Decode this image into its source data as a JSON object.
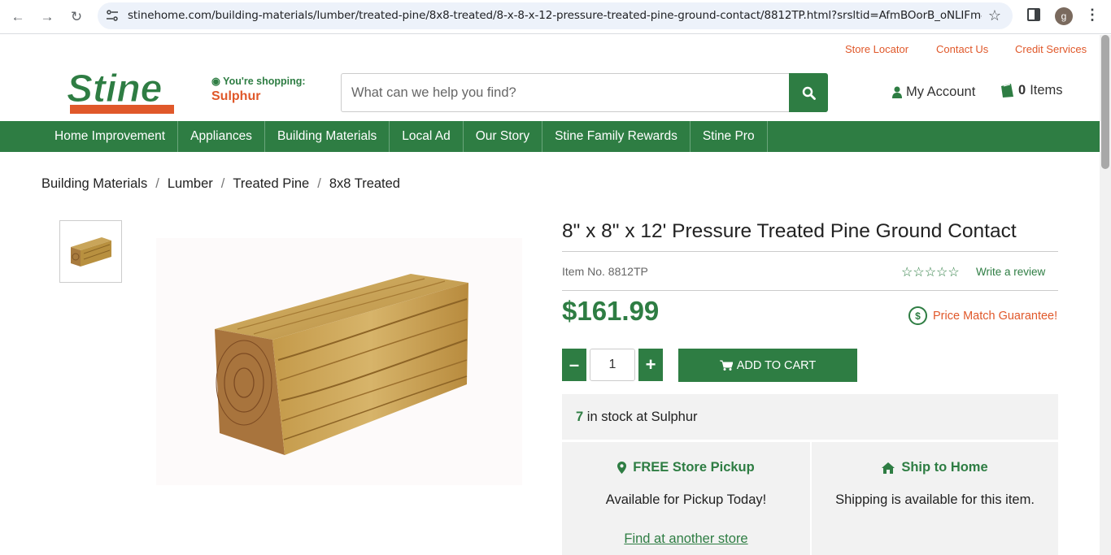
{
  "browser": {
    "url": "stinehome.com/building-materials/lumber/treated-pine/8x8-treated/8-x-8-x-12-pressure-treated-pine-ground-contact/8812TP.html?srsltid=AfmBOorB_oNLIFm4NqAfQ...",
    "profile_initial": "g"
  },
  "utility_links": [
    "Store Locator",
    "Contact Us",
    "Credit Services"
  ],
  "header": {
    "logo_text": "Stine",
    "shopping_label": "You're shopping:",
    "store_name": "Sulphur",
    "search_placeholder": "What can we help you find?",
    "account_label": "My Account",
    "cart_count": "0",
    "cart_label": "Items"
  },
  "main_nav": [
    "Home Improvement",
    "Appliances",
    "Building Materials",
    "Local Ad",
    "Our Story",
    "Stine Family Rewards",
    "Stine Pro"
  ],
  "breadcrumb": [
    "Building Materials",
    "Lumber",
    "Treated Pine",
    "8x8 Treated"
  ],
  "product": {
    "title": "8\" x 8\" x 12' Pressure Treated Pine Ground Contact",
    "item_no": "Item No. 8812TP",
    "rating_stars": 0,
    "write_review": "Write a review",
    "price": "$161.99",
    "price_match": "Price Match Guarantee!",
    "quantity": "1",
    "add_to_cart": "ADD TO CART"
  },
  "stock": {
    "count": "7",
    "text": "in stock at Sulphur"
  },
  "fulfillment": {
    "pickup": {
      "title": "FREE Store Pickup",
      "subtitle": "Available for Pickup Today!",
      "link": "Find at another store"
    },
    "ship": {
      "title": "Ship to Home",
      "subtitle": "Shipping is available for this item."
    }
  },
  "colors": {
    "brand_green": "#2e7d43",
    "accent_orange": "#e0582a"
  }
}
